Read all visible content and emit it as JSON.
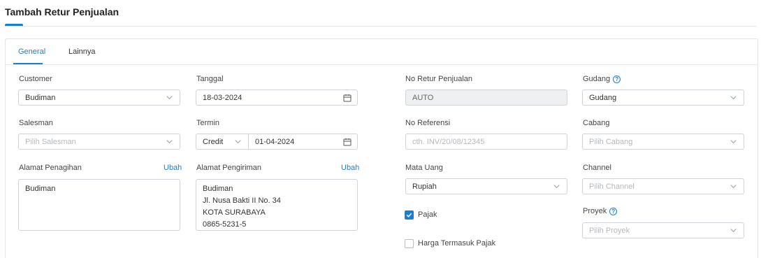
{
  "page": {
    "title": "Tambah Retur Penjualan"
  },
  "tabs": [
    {
      "label": "General"
    },
    {
      "label": "Lainnya"
    }
  ],
  "form": {
    "customer": {
      "label": "Customer",
      "value": "Budiman"
    },
    "tanggal": {
      "label": "Tanggal",
      "value": "18-03-2024"
    },
    "no_retur": {
      "label": "No Retur Penjualan",
      "value": "AUTO"
    },
    "gudang": {
      "label": "Gudang",
      "value": "Gudang"
    },
    "salesman": {
      "label": "Salesman",
      "placeholder": "Pilih Salesman"
    },
    "termin": {
      "label": "Termin",
      "type_value": "Credit",
      "date_value": "01-04-2024"
    },
    "no_referensi": {
      "label": "No Referensi",
      "placeholder": "cth. INV/20/08/12345"
    },
    "cabang": {
      "label": "Cabang",
      "placeholder": "Pilih Cabang"
    },
    "alamat_penagihan": {
      "label": "Alamat Penagihan",
      "edit_label": "Ubah",
      "value": "Budiman"
    },
    "alamat_pengiriman": {
      "label": "Alamat Pengiriman",
      "edit_label": "Ubah",
      "lines": [
        "Budiman",
        "Jl. Nusa Bakti II No. 34",
        "KOTA SURABAYA",
        "0865-5231-5"
      ]
    },
    "mata_uang": {
      "label": "Mata Uang",
      "value": "Rupiah"
    },
    "channel": {
      "label": "Channel",
      "placeholder": "Pilih Channel"
    },
    "pajak": {
      "label": "Pajak",
      "checked": true
    },
    "proyek": {
      "label": "Proyek",
      "placeholder": "Pilih Proyek"
    },
    "harga_termasuk_pajak": {
      "label": "Harga Termasuk Pajak",
      "checked": false
    }
  },
  "icons": {
    "help": "?"
  },
  "colors": {
    "accent": "#1a7fd4",
    "border": "#cfd4da",
    "disabled_bg": "#eef0f2"
  }
}
